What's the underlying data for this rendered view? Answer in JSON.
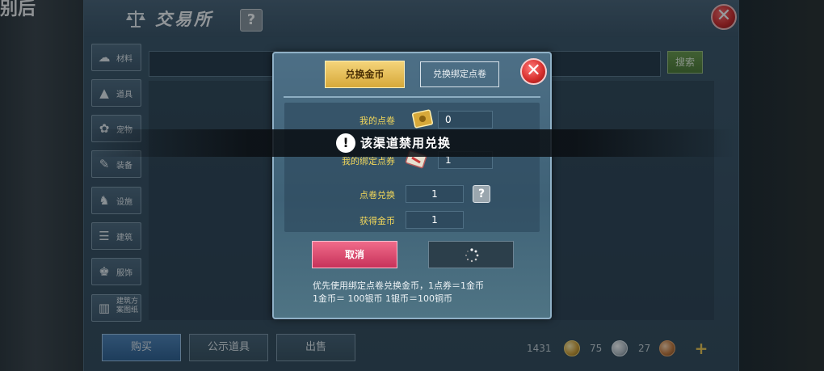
{
  "background": {
    "left_text": [
      "",
      "别后",
      ""
    ]
  },
  "window": {
    "title": "交易所",
    "help_label": "?",
    "close_label": "✕"
  },
  "categories": [
    {
      "label": "材料",
      "icon": "material-icon"
    },
    {
      "label": "道具",
      "icon": "item-icon"
    },
    {
      "label": "宠物",
      "icon": "pet-icon"
    },
    {
      "label": "装备",
      "icon": "equipment-icon"
    },
    {
      "label": "设施",
      "icon": "facility-icon"
    },
    {
      "label": "建筑",
      "icon": "building-icon"
    },
    {
      "label": "服饰",
      "icon": "clothing-icon"
    },
    {
      "label": "建筑方案图纸",
      "icon": "blueprint-icon"
    }
  ],
  "search": {
    "button_label": "搜索",
    "placeholder": ""
  },
  "bottom": {
    "tabs": [
      "购买",
      "公示道具",
      "出售"
    ],
    "currency": {
      "gold": "1431",
      "silver": "75",
      "copper": "27"
    },
    "plus_label": "+"
  },
  "dialog": {
    "tab_gold": "兑换金币",
    "tab_bind": "兑换绑定点卷",
    "close_label": "✕",
    "rows": {
      "my_points_label": "我的点卷",
      "my_points_value": "0",
      "my_bound_label": "我的绑定点券",
      "my_bound_value": "1",
      "exchange_label": "点卷兑换",
      "exchange_value": "1",
      "gain_label": "获得金币",
      "gain_value": "1"
    },
    "help_label": "?",
    "cancel_label": "取消",
    "note_line1": "优先使用绑定点卷兑换金币，1点券＝1金币",
    "note_line2": "1金币＝ 100银币   1银币＝100铜币"
  },
  "toast": {
    "icon": "!",
    "message": "该渠道禁用兑换"
  },
  "colors": {
    "accent_gold": "#d7a93a",
    "cancel_pink": "#c7325a",
    "label_yellow": "#f2d75a",
    "search_green": "#4d7a33"
  }
}
